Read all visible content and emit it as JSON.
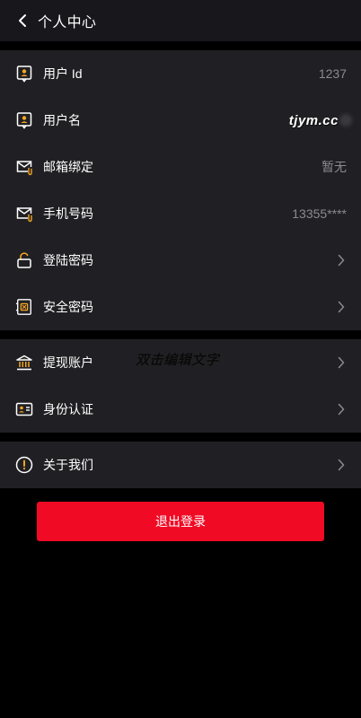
{
  "header": {
    "title": "个人中心",
    "back_icon": "chevron-left-icon"
  },
  "sections": [
    {
      "rows": [
        {
          "icon": "user-id-icon",
          "label": "用户 Id",
          "value": "1237"
        },
        {
          "icon": "user-name-icon",
          "label": "用户名",
          "value": "tjym.cc"
        },
        {
          "icon": "mail-icon",
          "label": "邮箱绑定",
          "value": "暂无"
        },
        {
          "icon": "phone-mail-icon",
          "label": "手机号码",
          "value": "13355****"
        },
        {
          "icon": "lock-icon",
          "label": "登陆密码",
          "value": ""
        },
        {
          "icon": "safe-icon",
          "label": "安全密码",
          "value": ""
        }
      ]
    },
    {
      "rows": [
        {
          "icon": "bank-icon",
          "label": "提现账户",
          "value": ""
        },
        {
          "icon": "id-card-icon",
          "label": "身份认证",
          "value": ""
        }
      ]
    },
    {
      "rows": [
        {
          "icon": "info-icon",
          "label": "关于我们",
          "value": ""
        }
      ]
    }
  ],
  "overlay_text": "双击编辑文字",
  "logout_label": "退出登录",
  "colors": {
    "accent": "#f10a24",
    "icon_orange": "#f5a623",
    "row_bg": "#202024",
    "header_bg": "#17171c",
    "page_bg": "#000000",
    "value_gray": "#8a8a8f"
  }
}
